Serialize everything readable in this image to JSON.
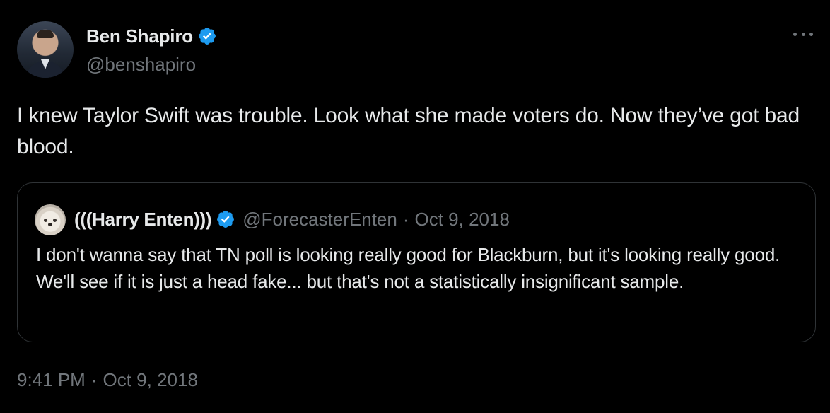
{
  "colors": {
    "background": "#000000",
    "primary_text": "#e7e9ea",
    "secondary_text": "#71767b",
    "border": "#2f3336",
    "verified_blue": "#1d9bf0"
  },
  "author": {
    "display_name": "Ben Shapiro",
    "handle": "@benshapiro",
    "avatar_icon": "avatar-photo",
    "verified_icon": "verified-badge-icon"
  },
  "tweet": {
    "text": "I knew Taylor Swift was trouble. Look what she made voters do. Now they’ve got bad blood.",
    "time": "9:41 PM",
    "separator": "·",
    "date": "Oct 9, 2018"
  },
  "quoted_tweet": {
    "display_name": "(((Harry Enten)))",
    "handle": "@ForecasterEnten",
    "separator": "·",
    "date": "Oct 9, 2018",
    "text": "I don't wanna say that TN poll is looking really good for Blackburn, but it's looking really good. We'll see if it is just a head fake... but that's not a statistically insignificant sample."
  }
}
